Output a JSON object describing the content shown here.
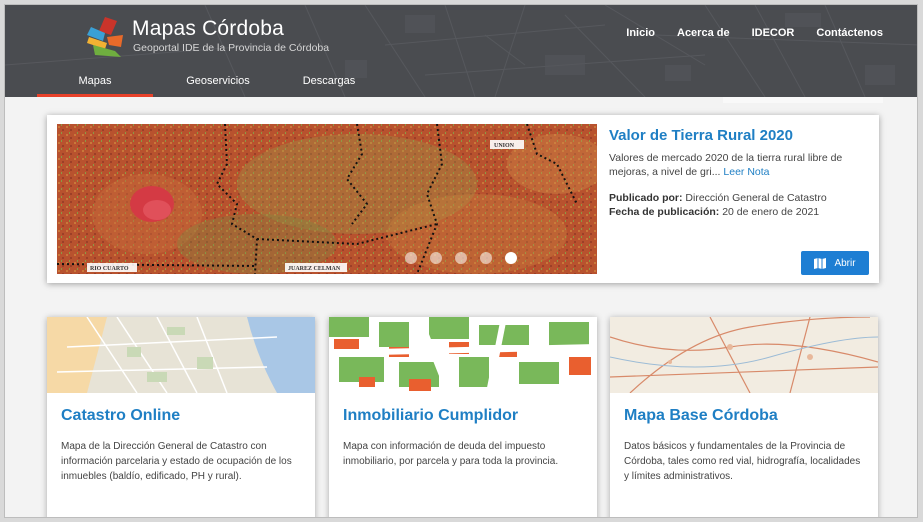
{
  "brand": {
    "title": "Mapas Córdoba",
    "subtitle": "Geoportal IDE de la Provincia de Córdoba"
  },
  "topnav": [
    "Inicio",
    "Acerca de",
    "IDECOR",
    "Contáctenos"
  ],
  "tabs": [
    "Mapas",
    "Geoservicios",
    "Descargas"
  ],
  "featured": {
    "title": "Valor de Tierra Rural 2020",
    "desc": "Valores de mercado 2020 de la tierra rural libre de mejoras, a nivel de gri...",
    "read_more": "Leer Nota",
    "published_by_label": "Publicado por:",
    "published_by": "Dirección General de Catastro",
    "date_label": "Fecha de publicación:",
    "date": "20 de enero de 2021",
    "open_label": "Abrir",
    "map_labels": [
      "UNION",
      "RIO CUARTO",
      "JUAREZ CELMAN"
    ]
  },
  "cards": [
    {
      "title": "Catastro Online",
      "desc": "Mapa de la Dirección General de Catastro con información parcelaria y estado de ocupación de los inmuebles (baldío, edificado, PH y rural)."
    },
    {
      "title": "Inmobiliario Cumplidor",
      "desc": "Mapa con información de deuda del impuesto inmobiliario, por parcela y para toda la provincia."
    },
    {
      "title": "Mapa Base Córdoba",
      "desc": "Datos básicos y fundamentales de la Provincia de Córdoba, tales como red vial, hidrografía, localidades y límites administrativos."
    }
  ],
  "colors": {
    "header": "#4a4c50",
    "accent_blue": "#1f7fc4",
    "tab_active": "#e8412a",
    "button": "#1e7ed3"
  }
}
